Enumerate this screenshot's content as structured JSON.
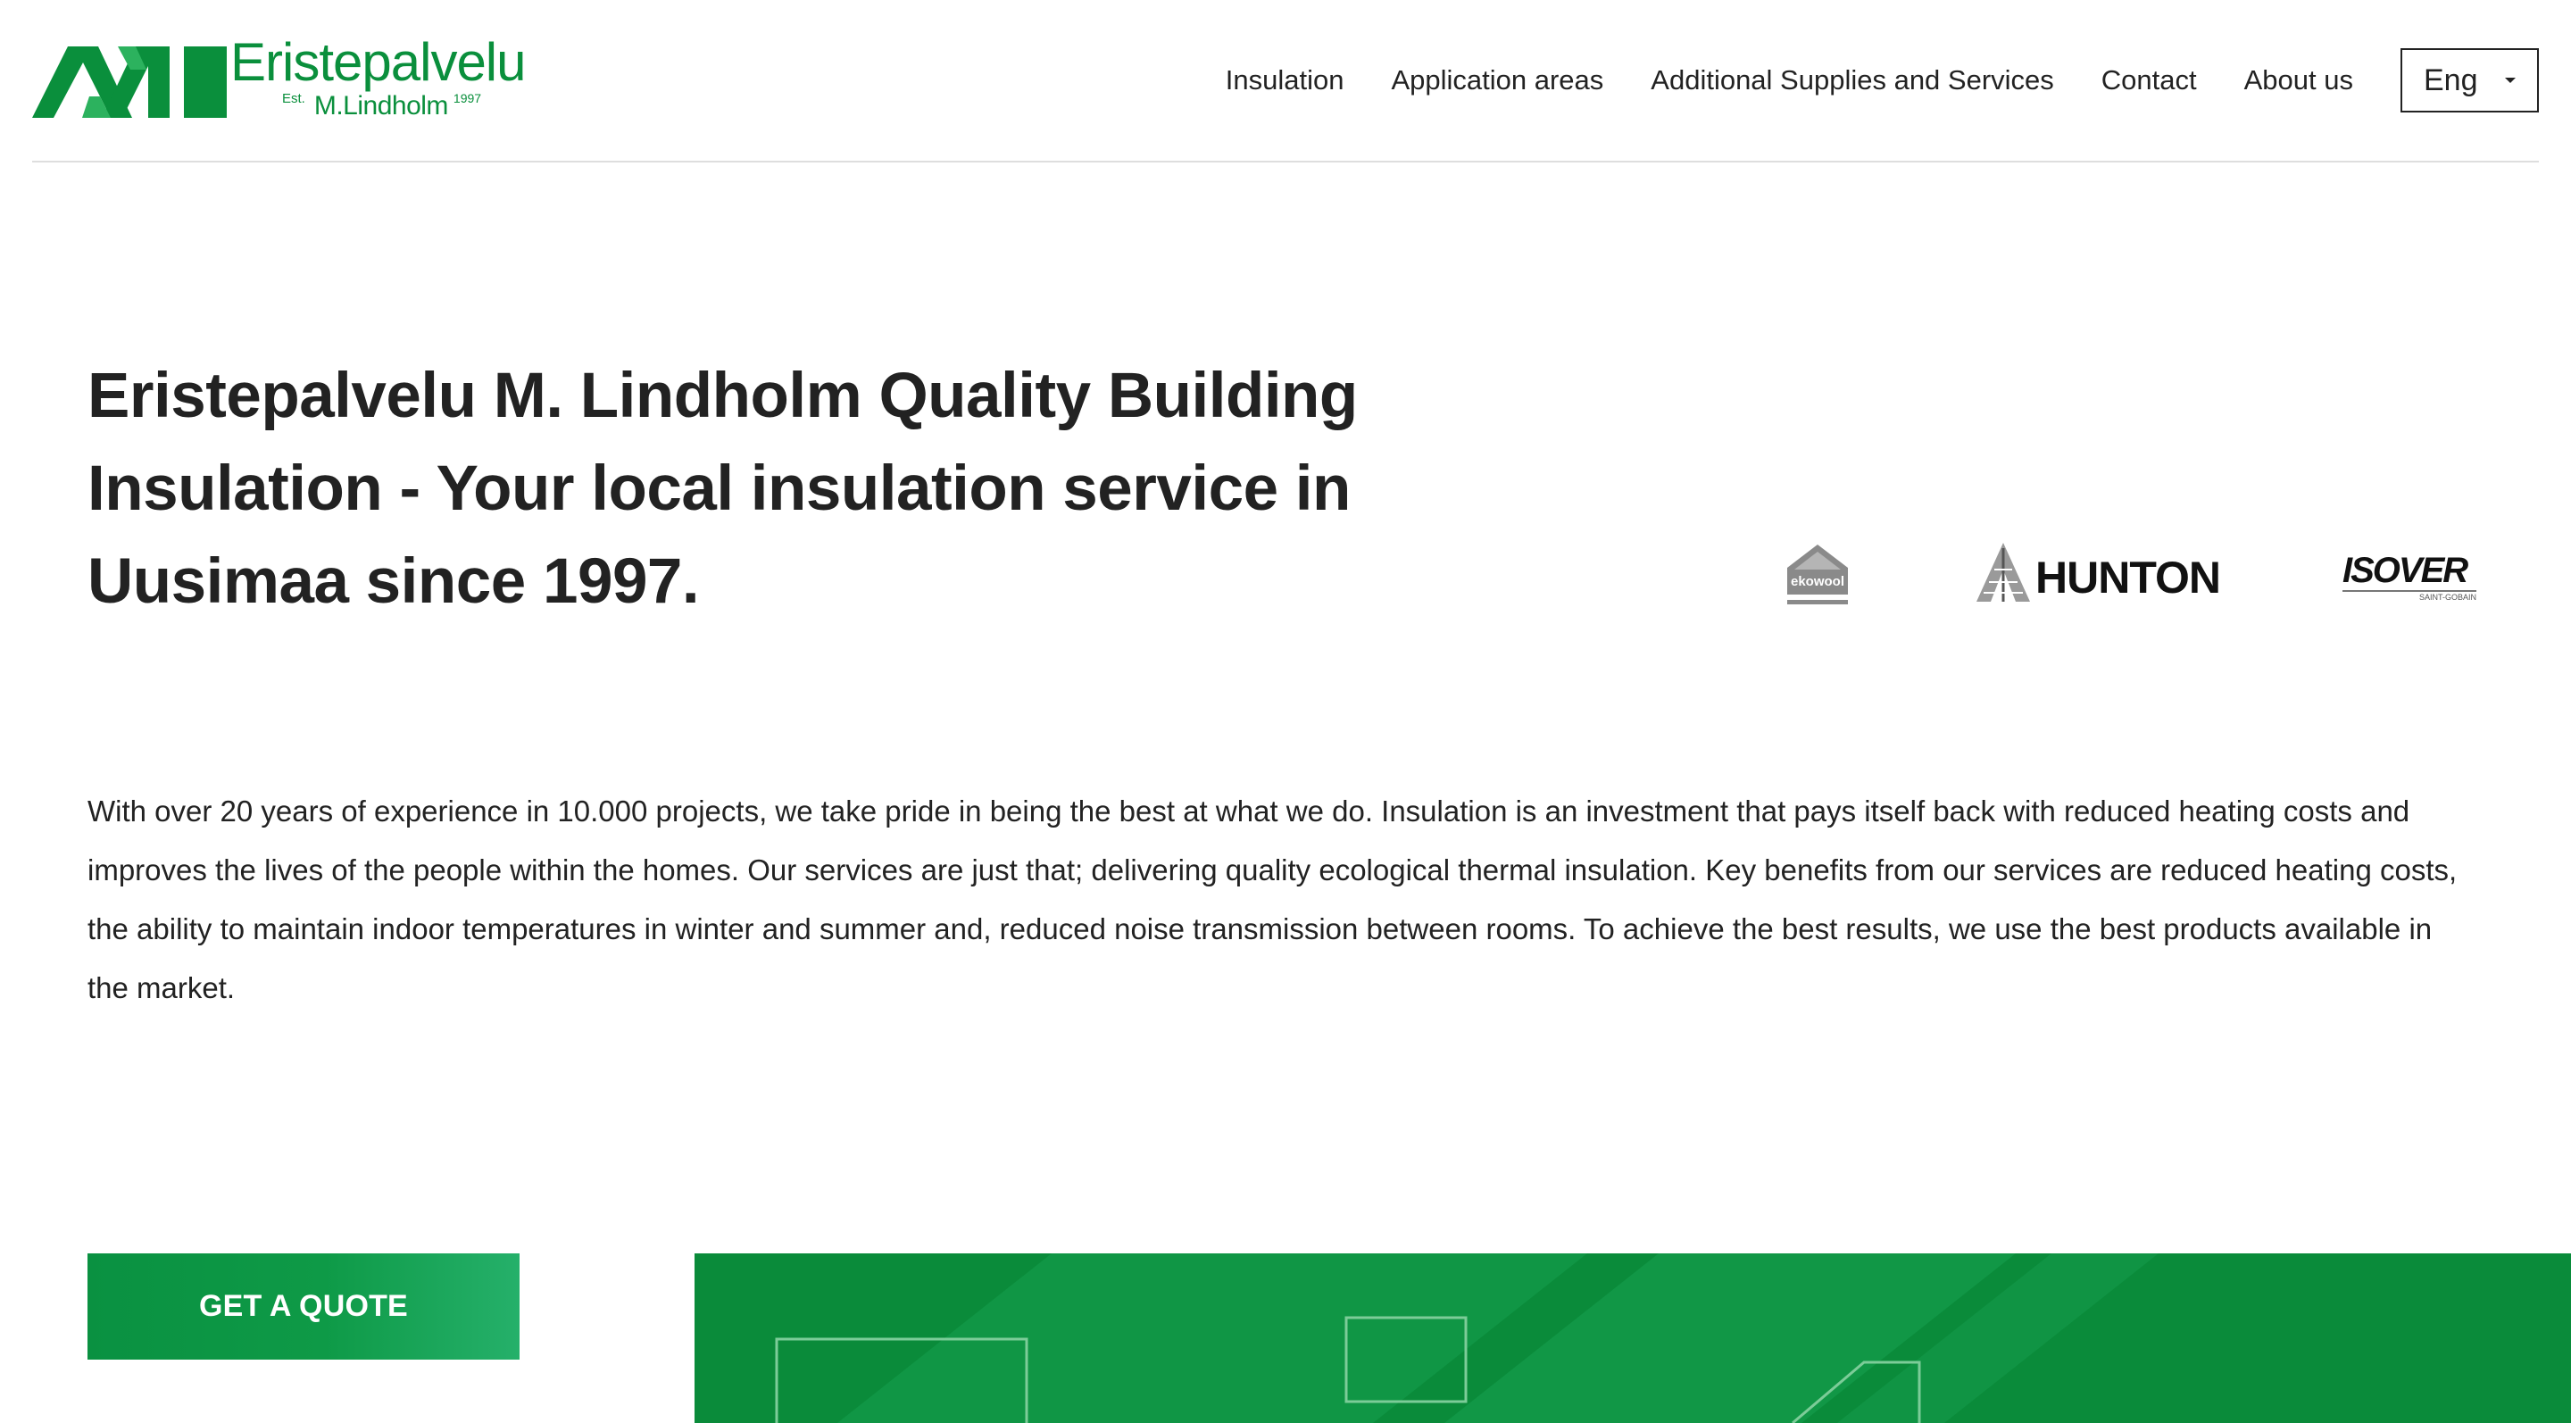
{
  "brand": {
    "name": "Eristepalvelu",
    "est": "Est.",
    "owner": "M.Lindholm",
    "year": "1997"
  },
  "nav": {
    "items": [
      {
        "label": "Insulation"
      },
      {
        "label": "Application areas"
      },
      {
        "label": "Additional Supplies and Services"
      },
      {
        "label": "Contact"
      },
      {
        "label": "About us"
      }
    ],
    "language": "Eng"
  },
  "hero": {
    "title": "Eristepalvelu M. Lindholm Quality Building Insulation - Your local insulation service in Uusimaa since 1997.",
    "intro": "With over 20 years of experience in 10.000 projects, we take pride in being the best at what we do. Insulation is an investment that pays itself back with reduced heating costs and improves the lives of the people within the homes. Our services are just that; delivering quality ecological thermal insulation. Key benefits from our services are reduced heating costs, the ability to maintain indoor temperatures in winter and summer and, reduced noise transmission between rooms. To achieve the best results, we use the best products available in the market."
  },
  "partners": {
    "ekowool": "ekowool",
    "hunton": "HUNTON",
    "isover": "ISOVER",
    "isover_sub": "SAINT-GOBAIN"
  },
  "cta": {
    "label": "GET A QUOTE"
  },
  "colors": {
    "brand_green": "#0a8f3c",
    "text": "#222222",
    "divider": "#dedede"
  }
}
